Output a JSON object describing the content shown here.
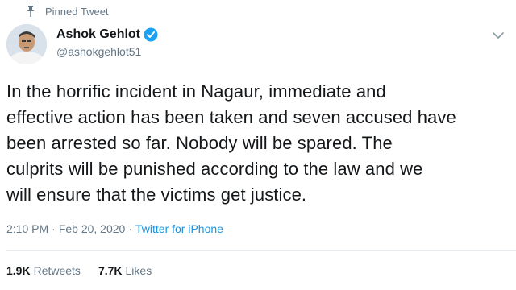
{
  "pinned": {
    "label": "Pinned Tweet",
    "icon": "pin-icon"
  },
  "author": {
    "display_name": "Ashok Gehlot",
    "handle": "@ashokgehlot51",
    "verified": true,
    "verified_icon": "verified-badge-icon",
    "verified_color": "#1da1f2"
  },
  "menu_icon": "chevron-down-icon",
  "tweet": {
    "lines": [
      "In the horrific incident in Nagaur, immediate and",
      "effective action has been taken and seven accused have",
      "been arrested so far. Nobody will be spared. The",
      "culprits will be punished according to the law and we",
      "will ensure that the victims get justice."
    ]
  },
  "meta": {
    "time": "2:10 PM",
    "separator": "·",
    "date": "Feb 20, 2020",
    "source": "Twitter for iPhone",
    "link_color": "#1b95e0"
  },
  "stats": {
    "retweets_count": "1.9K",
    "retweets_label": "Retweets",
    "likes_count": "7.7K",
    "likes_label": "Likes"
  }
}
